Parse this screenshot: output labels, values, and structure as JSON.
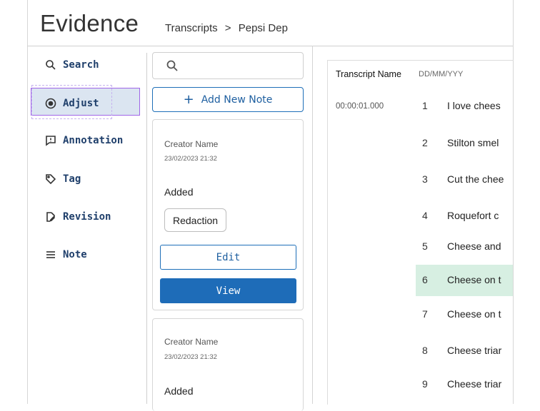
{
  "header": {
    "title": "Evidence",
    "breadcrumb": [
      "Transcripts",
      ">",
      "Pepsi Dep"
    ]
  },
  "nav": {
    "items": [
      {
        "label": "Search",
        "icon": "search-icon"
      },
      {
        "label": "Adjust",
        "icon": "radio-target-icon",
        "active": true
      },
      {
        "label": "Annotation",
        "icon": "comment-alert-icon"
      },
      {
        "label": "Tag",
        "icon": "tag-icon"
      },
      {
        "label": "Revision",
        "icon": "file-edit-icon"
      },
      {
        "label": "Note",
        "icon": "menu-lines-icon"
      }
    ],
    "active_color": "#dbe5f1"
  },
  "notes": {
    "search_placeholder": "",
    "add_label": "Add New Note",
    "cards": [
      {
        "creator": "Creator Name",
        "date": "23/02/2023 21:32",
        "status": "Added",
        "chip": "Redaction",
        "edit_label": "Edit",
        "view_label": "View"
      },
      {
        "creator": "Creator Name",
        "date": "23/02/2023 21:32",
        "status": "Added"
      }
    ]
  },
  "transcript": {
    "name": "Transcript Name",
    "date_format": "DD/MM/YYY",
    "timestamp": "00:00:01.000",
    "lines": [
      {
        "n": "1",
        "text": "I love chees"
      },
      {
        "n": "2",
        "text": "Stilton smel"
      },
      {
        "n": "3",
        "text": "Cut the chee"
      },
      {
        "n": "4",
        "text": "Roquefort c"
      },
      {
        "n": "5",
        "text": "Cheese and"
      },
      {
        "n": "6",
        "text": "Cheese on t",
        "highlight": true
      },
      {
        "n": "7",
        "text": "Cheese on t"
      },
      {
        "n": "8",
        "text": "Cheese triar"
      },
      {
        "n": "9",
        "text": "Cheese triar"
      }
    ],
    "highlight_color": "#d7efe2"
  },
  "colors": {
    "primary": "#1e6cb8",
    "nav_text": "#1f3f6b"
  }
}
